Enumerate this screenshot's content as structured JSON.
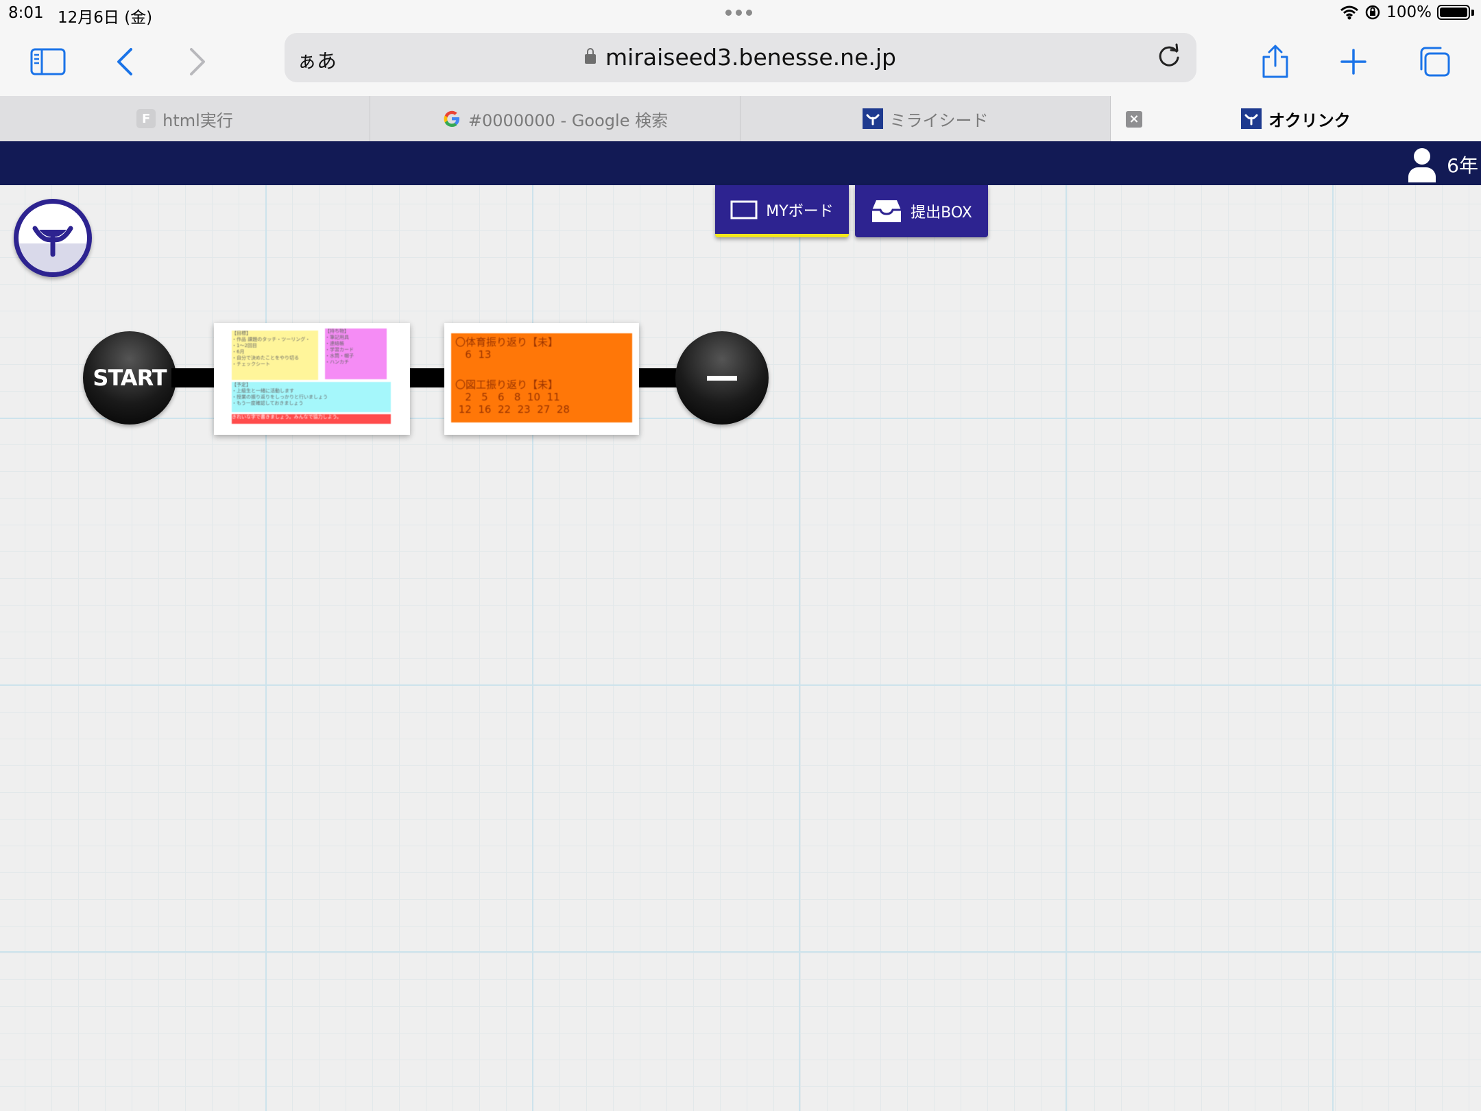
{
  "status_bar": {
    "time": "8:01",
    "date": "12月6日 (金)",
    "battery": "100%"
  },
  "toolbar": {
    "aa_label": "ぁあ",
    "url": "miraiseed3.benesse.ne.jp"
  },
  "tabs": [
    {
      "label": "html実行",
      "favicon_letter": "F"
    },
    {
      "label": "#0000000 - Google 検索"
    },
    {
      "label": "ミライシード"
    },
    {
      "label": "オクリンク"
    }
  ],
  "header": {
    "grade": "6年"
  },
  "buttons": {
    "myboard": "MYボード",
    "submit_box": "提出BOX"
  },
  "flow": {
    "start_label": "START",
    "card1": {
      "yellow": [
        "【目標】",
        "・作品 課題のタッチ・ツーリング・",
        "・1〜2回目",
        "・6月",
        "・自分で決めたことをやり切る",
        "・チェックシート"
      ],
      "pink": [
        "【持ち物】",
        "・筆記用具",
        "・連絡帳",
        "・学習カード",
        "・水筒・帽子",
        "・ハンカチ"
      ],
      "cyan": [
        "【予定】",
        "・上級生と一緒に活動します",
        "・授業の振り返りをしっかりと行いましょう",
        "・もう一度確認しておきましょう"
      ],
      "red": "きれいな字で書きましょう。みんなで協力しよう。"
    },
    "card2": {
      "line1": "〇体育振り返り【未】",
      "line2": "   6  13",
      "line3": "〇図工振り返り【未】",
      "line4": "   2   5   6   8  10  11",
      "line5": " 12  16  22  23  27  28"
    }
  },
  "colors": {
    "header_bg": "#121a55",
    "button_bg": "#2d2390",
    "active_underline": "#f3e61c",
    "card2_bg": "#ff7708",
    "note_yellow": "#fff59a",
    "note_pink": "#f58cf5",
    "note_cyan": "#a5f7fb",
    "note_red": "#ff4c4c",
    "ios_blue": "#1a73e8"
  },
  "icons": {
    "sidebar": "sidebar-icon",
    "back": "chevron-left-icon",
    "forward": "chevron-right-icon",
    "reload": "reload-icon",
    "share": "share-icon",
    "new_tab": "plus-icon",
    "tabs": "tabs-icon",
    "user": "user-icon",
    "logo": "sprout-logo-icon"
  }
}
